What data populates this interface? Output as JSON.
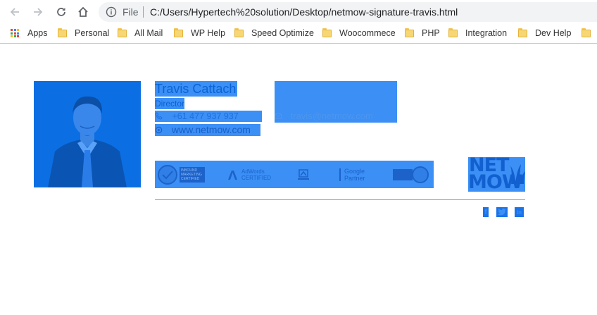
{
  "browser": {
    "omnibox": {
      "scheme": "File",
      "url": "C:/Users/Hypertech%20solution/Desktop/netmow-signature-travis.html"
    },
    "bookmarks": [
      "Apps",
      "Personal",
      "All Mail",
      "WP Help",
      "Speed Optimize",
      "Woocommece",
      "PHP",
      "Integration",
      "Dev Help"
    ]
  },
  "signature": {
    "name": "Travis Cattach",
    "title": "Director",
    "phone": "+61 477 937 937",
    "email": "travis@netmow.com",
    "website": "www.netmow.com",
    "certifications": [
      "INBOUND MARKETING CERTIFIED",
      "AdWords CERTIFIED",
      "Google Partner"
    ],
    "logo_lines": [
      "NET",
      "MOW"
    ],
    "social": [
      "facebook-icon",
      "twitter-icon",
      "linkedin-icon"
    ]
  },
  "colors": {
    "selection": "#3b8ff5",
    "photo_bg": "#0b6fe3",
    "text_blue": "#0a63d4"
  }
}
